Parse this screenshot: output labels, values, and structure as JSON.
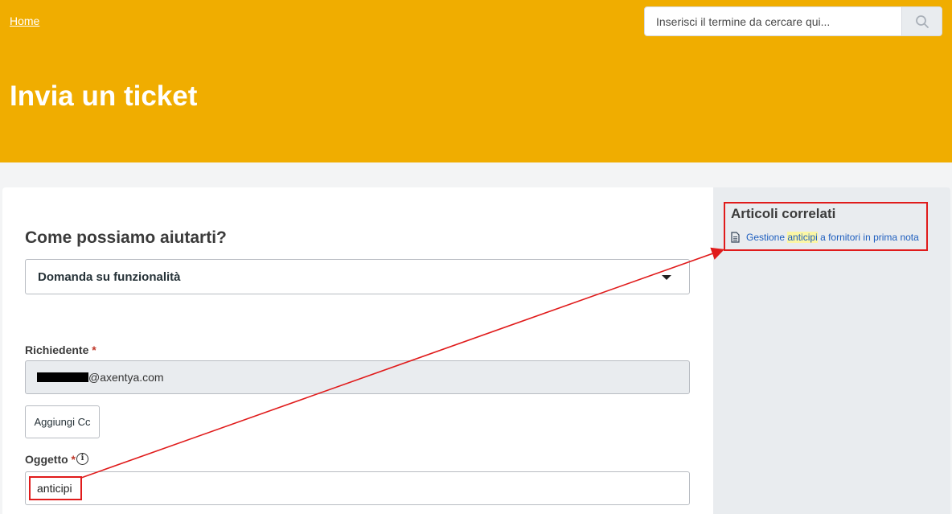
{
  "header": {
    "breadcrumb_home": "Home",
    "search_placeholder": "Inserisci il termine da cercare qui...",
    "page_title": "Invia un ticket",
    "background_color": "#f0ad00"
  },
  "form": {
    "section_title": "Come possiamo aiutarti?",
    "ticket_type_value": "Domanda su funzionalità",
    "requester_label": "Richiedente",
    "requester_suffix": "@axentya.com",
    "add_cc_label": "Aggiungi Cc",
    "subject_label": "Oggetto",
    "subject_value": "anticipi",
    "required_mark": "*"
  },
  "related": {
    "title": "Articoli correlati",
    "articles": [
      {
        "before": "Gestione ",
        "highlight": "anticipi",
        "after": " a fornitori in prima nota",
        "icon": "document-icon"
      }
    ]
  },
  "annotation": {
    "color": "#e01b1b"
  }
}
